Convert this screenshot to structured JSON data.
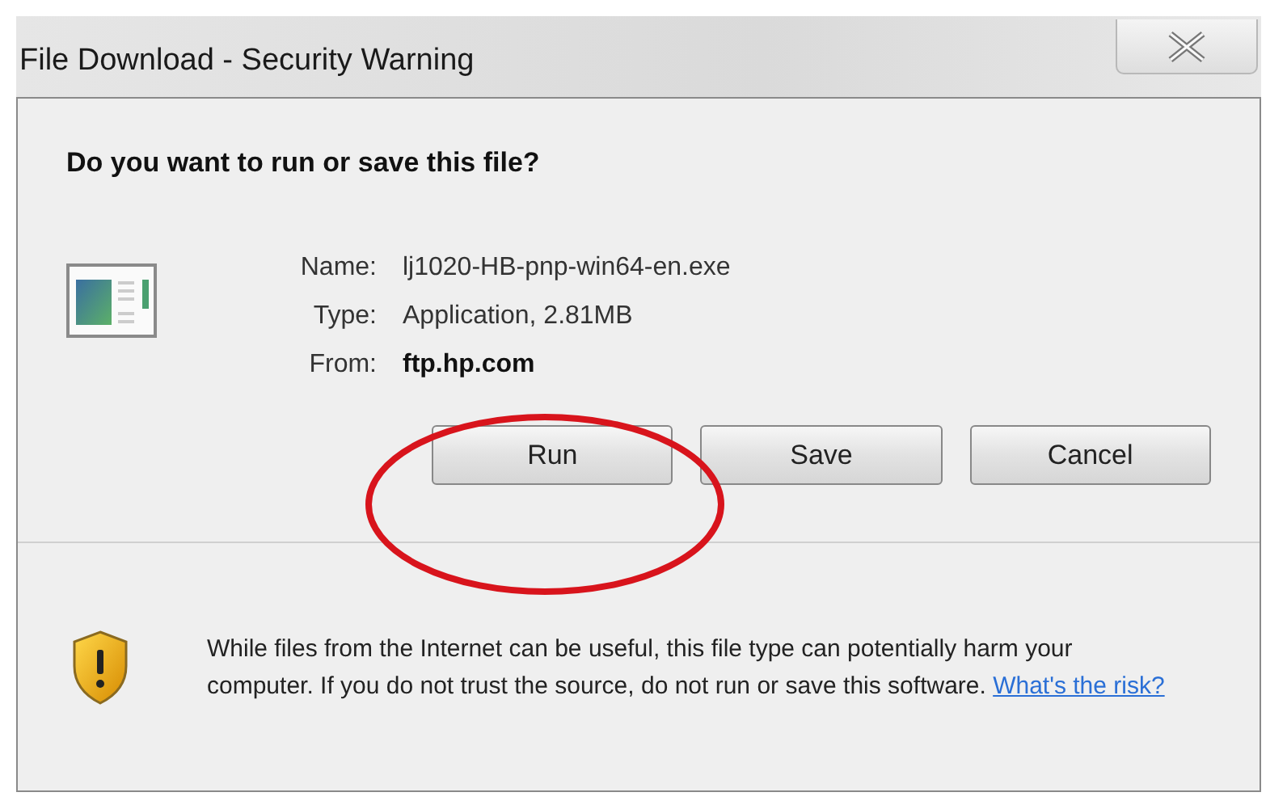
{
  "window": {
    "title": "File Download - Security Warning"
  },
  "heading": "Do you want to run or save this file?",
  "details": [
    {
      "label": "Name:",
      "value": "lj1020-HB-pnp-win64-en.exe",
      "bold": false
    },
    {
      "label": "Type:",
      "value": "Application, 2.81MB",
      "bold": false
    },
    {
      "label": "From:",
      "value": "ftp.hp.com",
      "bold": true
    }
  ],
  "buttons": [
    {
      "label": "Run",
      "circled": true
    },
    {
      "label": "Save",
      "circled": false
    },
    {
      "label": "Cancel",
      "circled": false
    }
  ],
  "warning": {
    "text": "While files from the Internet can be useful, this file type can potentially harm your computer. If you do not trust the source, do not run or save this software.",
    "link": "What's the risk?"
  }
}
